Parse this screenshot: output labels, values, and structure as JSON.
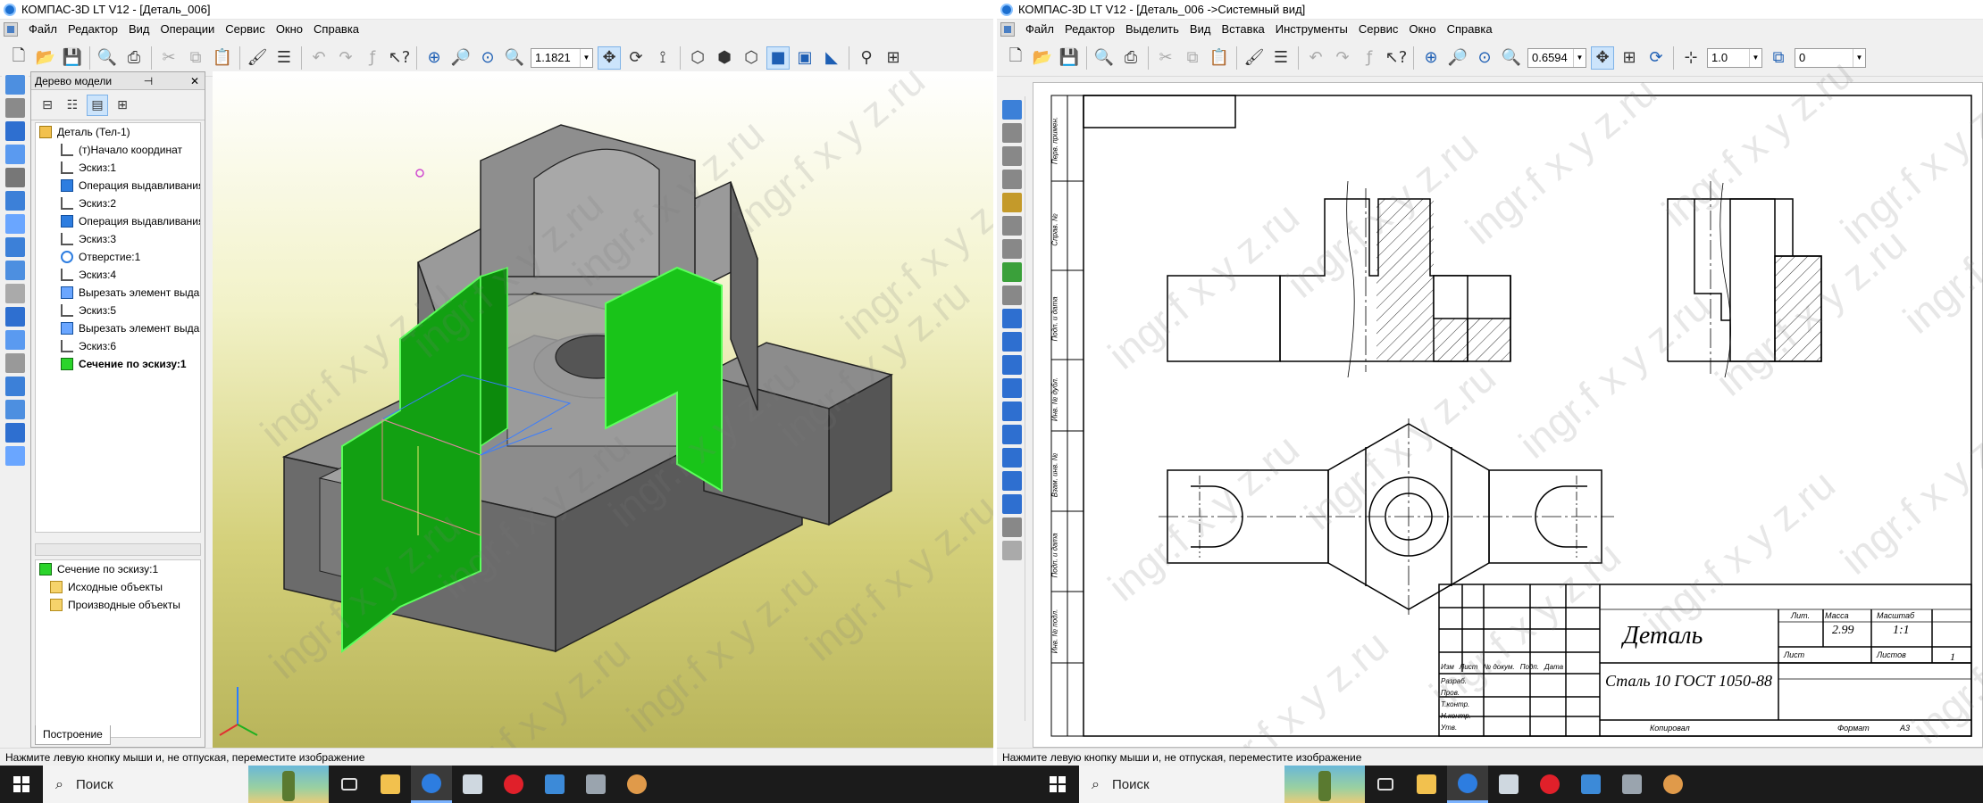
{
  "left_window": {
    "title": "КОМПАС-3D LT V12 - [Деталь_006]",
    "menu": [
      "Файл",
      "Редактор",
      "Вид",
      "Операции",
      "Сервис",
      "Окно",
      "Справка"
    ],
    "zoom_value": "1.1821",
    "tree_panel": {
      "title": "Дерево модели",
      "pin": "⊣",
      "close": "✕",
      "items": [
        {
          "label": "Деталь (Тел-1)",
          "icon": "part",
          "indent": 0
        },
        {
          "label": "(т)Начало координат",
          "icon": "axis",
          "indent": 2
        },
        {
          "label": "Эскиз:1",
          "icon": "sketch",
          "indent": 2
        },
        {
          "label": "Операция выдавливания",
          "icon": "op",
          "indent": 2
        },
        {
          "label": "Эскиз:2",
          "icon": "sketch",
          "indent": 2
        },
        {
          "label": "Операция выдавливания",
          "icon": "op",
          "indent": 2
        },
        {
          "label": "Эскиз:3",
          "icon": "sketch",
          "indent": 2
        },
        {
          "label": "Отверстие:1",
          "icon": "hole",
          "indent": 2
        },
        {
          "label": "Эскиз:4",
          "icon": "sketch",
          "indent": 2
        },
        {
          "label": "Вырезать элемент выдав",
          "icon": "cut",
          "indent": 2
        },
        {
          "label": "Эскиз:5",
          "icon": "sketch",
          "indent": 2
        },
        {
          "label": "Вырезать элемент выдав",
          "icon": "cut",
          "indent": 2
        },
        {
          "label": "Эскиз:6",
          "icon": "sketch",
          "indent": 2
        },
        {
          "label": "Сечение по эскизу:1",
          "icon": "sec",
          "indent": 2,
          "bold": true
        }
      ],
      "sub_items": [
        {
          "label": "Сечение по эскизу:1",
          "icon": "sec",
          "indent": 0
        },
        {
          "label": "Исходные объекты",
          "icon": "folder",
          "indent": 1
        },
        {
          "label": "Производные объекты",
          "icon": "folder",
          "indent": 1
        }
      ],
      "tab": "Построение"
    },
    "status": "Нажмите левую кнопку мыши и, не отпуская, переместите изображение"
  },
  "right_window": {
    "title": "КОМПАС-3D LT V12 - [Деталь_006 ->Системный вид]",
    "menu": [
      "Файл",
      "Редактор",
      "Выделить",
      "Вид",
      "Вставка",
      "Инструменты",
      "Сервис",
      "Окно",
      "Справка"
    ],
    "zoom_value": "0.6594",
    "line_scale": "1.0",
    "layer_value": "0",
    "title_block": {
      "part_name": "Деталь",
      "material": "Сталь 10  ГОСТ 1050-88",
      "mass": "2.99",
      "scale": "1:1",
      "header_cols": [
        "Изм",
        "Лист",
        "№ докум.",
        "Подп.",
        "Дата"
      ],
      "rows": [
        "Разраб.",
        "Пров.",
        "Т.контр.",
        "Н.контр.",
        "Утв."
      ],
      "lit": "Лит.",
      "mass_label": "Масса",
      "scale_label": "Масштаб",
      "sheet": "Лист",
      "sheets": "Листов",
      "sheets_count": "1",
      "copied": "Копировал",
      "format": "Формат",
      "format_value": "A3"
    },
    "side_labels": [
      "Перв. примен.",
      "Справ. №",
      "Подп. и дата",
      "Инв. № дубл.",
      "Взам. инв. №",
      "Подп. и дата",
      "Инв. № подл."
    ],
    "status": "Нажмите левую кнопку мыши и, не отпуская, переместите изображение"
  },
  "watermark": "ingr.f x y z.ru",
  "taskbar": {
    "search_label": "Поиск"
  },
  "icons": [
    "new-icon",
    "open-icon",
    "save-icon",
    "print-icon",
    "cut-icon",
    "copy-icon",
    "paste-icon",
    "undo-icon",
    "redo-icon",
    "fx-icon",
    "help-icon",
    "zoom-icon",
    "pan-icon",
    "rotate-icon",
    "iso-icon",
    "search-icon",
    "start-icon"
  ]
}
